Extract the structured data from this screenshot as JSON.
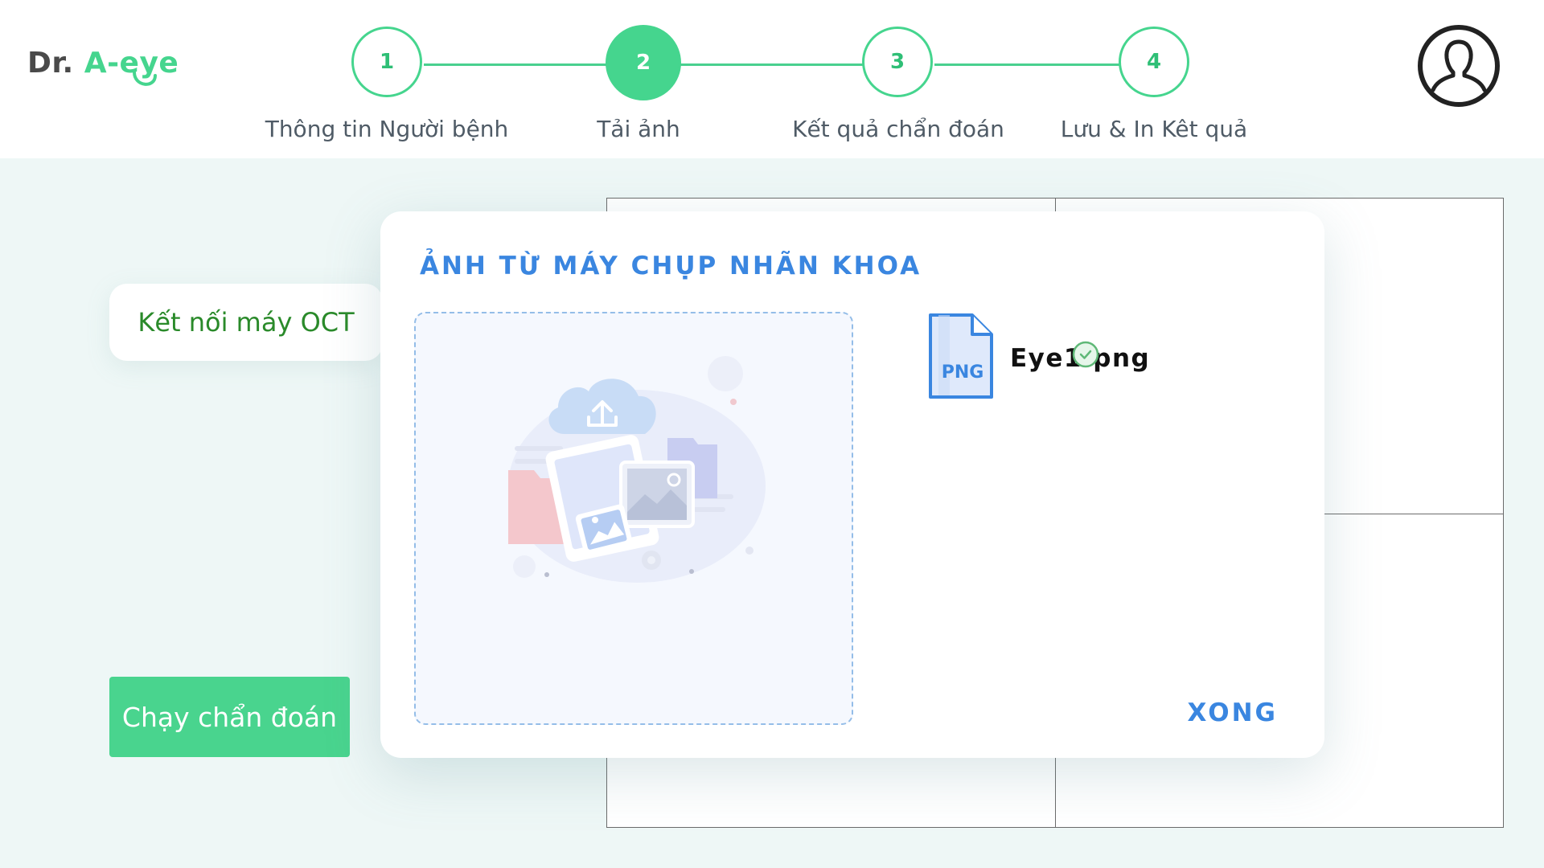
{
  "app": {
    "logo_prefix": "Dr.",
    "logo_name": "A-eye"
  },
  "stepper": {
    "steps": [
      {
        "number": "1",
        "label": "Thông tin Người bệnh"
      },
      {
        "number": "2",
        "label": "Tải ảnh"
      },
      {
        "number": "3",
        "label": "Kết quả chẩn đoán"
      },
      {
        "number": "4",
        "label": "Lưu & In Kêt quả"
      }
    ],
    "active_step": 2
  },
  "user": {
    "avatar_icon": "user-avatar-icon"
  },
  "sidebar": {
    "connect_label": "Kết nối máy OCT",
    "run_label": "Chạy chẩn đoán"
  },
  "modal": {
    "title": "ẢNH TỪ MÁY CHỤP NHÃN KHOA",
    "dropzone_icon": "upload-illustration-icon",
    "files": [
      {
        "name": "Eye1.png",
        "type_label": "PNG",
        "status": "uploaded"
      }
    ],
    "done_label": "XONG"
  },
  "colors": {
    "brand_green": "#45d58e",
    "accent_blue": "#3a86e0",
    "text_gray": "#4f5b66",
    "background": "#eef7f6"
  }
}
